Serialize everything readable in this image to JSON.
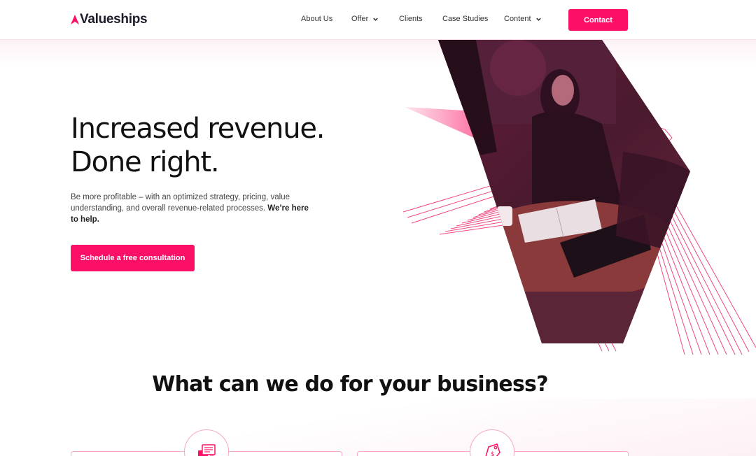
{
  "brand": {
    "name": "Valueships",
    "accent": "#fc0f66"
  },
  "nav": {
    "about": "About Us",
    "offer": "Offer",
    "clients": "Clients",
    "case_studies": "Case Studies",
    "content": "Content",
    "contact": "Contact"
  },
  "hero": {
    "headline_line1": "Increased revenue.",
    "headline_line2": "Done right.",
    "sub_text": "Be more profitable – with an optimized strategy, pricing, value understanding, and overall revenue-related processes.",
    "sub_bold": "We’re here to help.",
    "cta": "Schedule a free consultation"
  },
  "services": {
    "title": "What can we do for your business?",
    "icons": [
      "chat-bubbles-icon",
      "price-tag-icon"
    ]
  }
}
